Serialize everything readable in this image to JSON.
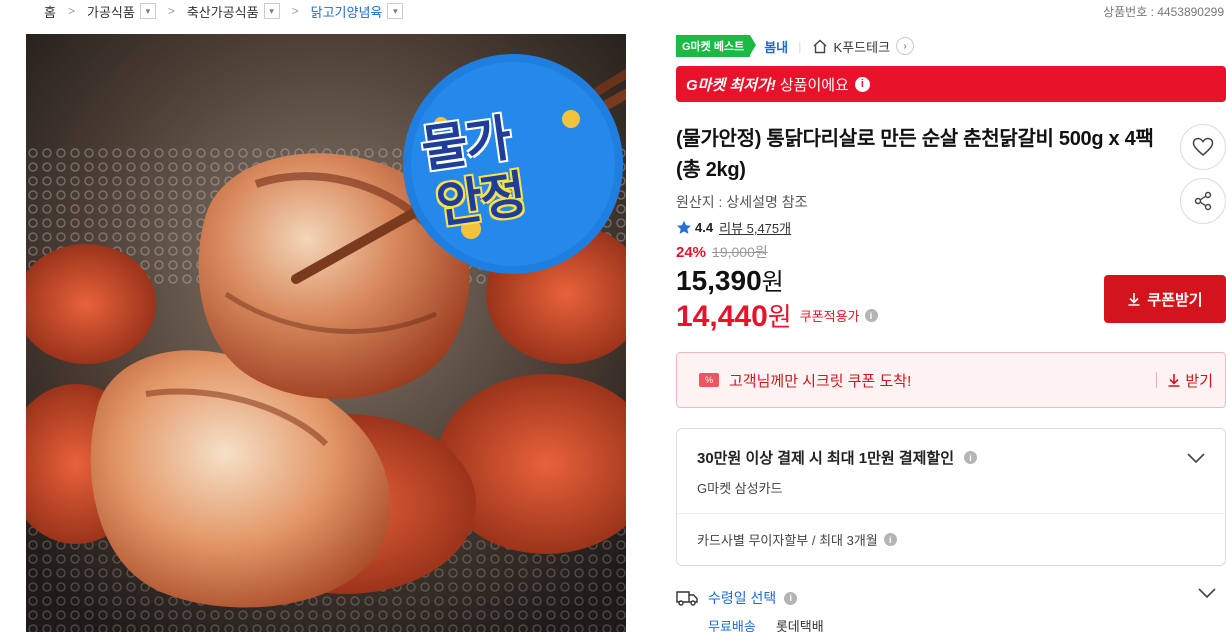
{
  "breadcrumb": {
    "items": [
      {
        "label": "홈"
      },
      {
        "label": "가공식품"
      },
      {
        "label": "축산가공식품"
      },
      {
        "label": "닭고기양념육"
      }
    ],
    "separator": ">"
  },
  "product_no": "상품번호 : 4453890299",
  "image": {
    "sticker_line1": "물가",
    "sticker_line2": "안정"
  },
  "badges": {
    "best": "G마켓 베스트",
    "season": "봄내",
    "store": "K푸드테크"
  },
  "lowest_banner": {
    "strong": "G마켓 최저가!",
    "rest": "상품이에요",
    "info_icon": "i"
  },
  "product": {
    "title": "(물가안정) 통닭다리살로 만든 순살 춘천닭갈비 500g x 4팩 (총 2kg)",
    "origin": "원산지 : 상세설명 참조",
    "rating": "4.4",
    "review_label": "리뷰 5,475개",
    "discount_rate": "24%",
    "original_price": "19,000원",
    "sale_price": "15,390",
    "coupon_price": "14,440",
    "won": "원",
    "coupon_price_label": "쿠폰적용가"
  },
  "coupon_button": "쿠폰받기",
  "secret_coupon": {
    "icon": "%",
    "text": "고객님께만 시크릿 쿠폰 도착!",
    "action": "받기"
  },
  "card_discount": {
    "title": "30만원 이상 결제 시 최대 1만원 결제할인",
    "sub": "G마켓 삼성카드",
    "installment": "카드사별 무이자할부 / 최대 3개월"
  },
  "delivery": {
    "label": "수령일 선택",
    "free": "무료배송",
    "carrier": "롯데택배"
  },
  "colors": {
    "accent_red": "#e8132a",
    "coupon_red": "#d3141c",
    "link_blue": "#1a6dd1",
    "best_green": "#1cb944"
  }
}
